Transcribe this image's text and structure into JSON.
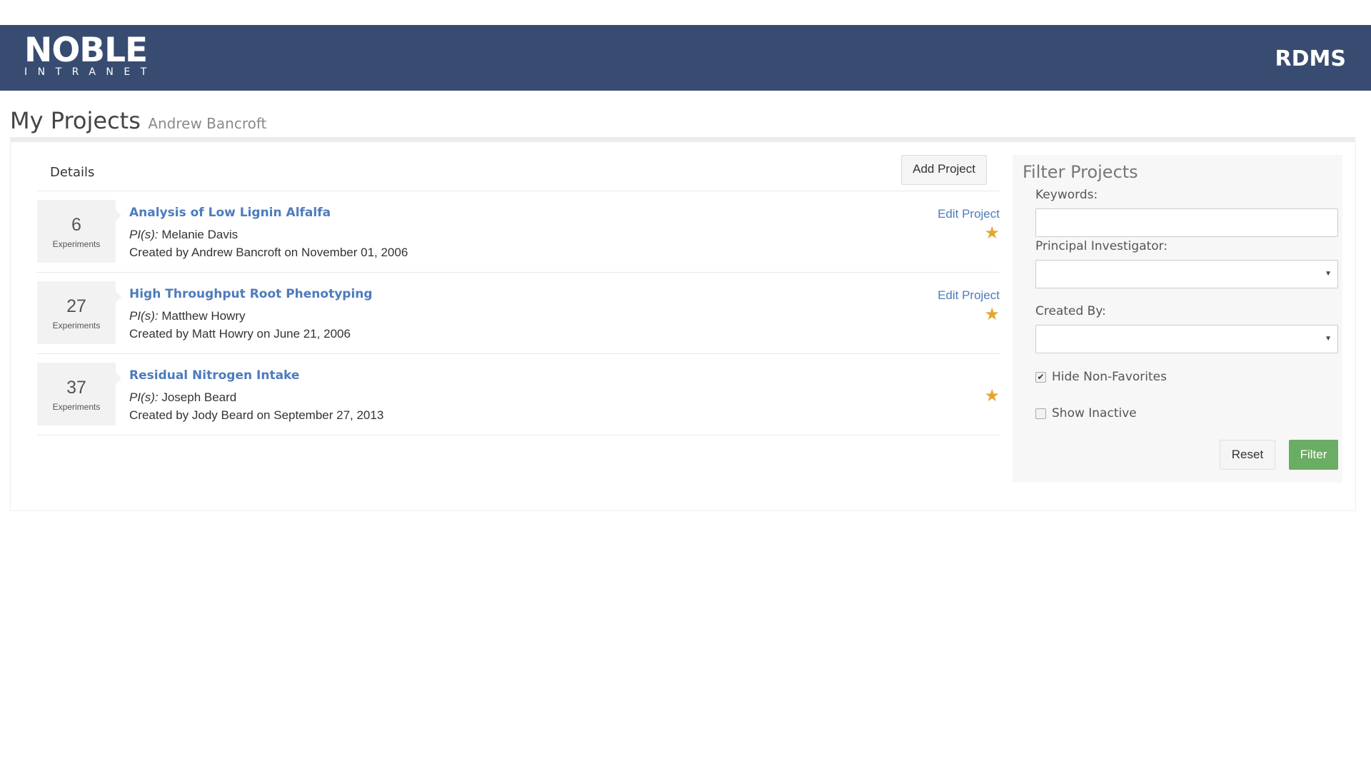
{
  "header": {
    "logo_main": "NOBLE",
    "logo_sub": "INTRANET",
    "app_name": "RDMS"
  },
  "page": {
    "title": "My Projects",
    "user": "Andrew Bancroft"
  },
  "list": {
    "details_label": "Details",
    "add_project_label": "Add Project",
    "experiments_label": "Experiments",
    "pi_label": "PI(s):",
    "edit_label": "Edit Project",
    "projects": [
      {
        "count": "6",
        "title": "Analysis of Low Lignin Alfalfa",
        "pi": "Melanie Davis",
        "created": "Created by Andrew Bancroft on November 01, 2006",
        "editable": true,
        "favorite": true
      },
      {
        "count": "27",
        "title": "High Throughput Root Phenotyping",
        "pi": "Matthew Howry",
        "created": "Created by Matt Howry on June 21, 2006",
        "editable": true,
        "favorite": true
      },
      {
        "count": "37",
        "title": "Residual Nitrogen Intake",
        "pi": "Joseph Beard",
        "created": "Created by Jody Beard on September 27, 2013",
        "editable": false,
        "favorite": true
      }
    ]
  },
  "filter": {
    "title": "Filter Projects",
    "keywords_label": "Keywords:",
    "keywords_value": "",
    "pi_label": "Principal Investigator:",
    "pi_value": "",
    "created_by_label": "Created By:",
    "created_by_value": "",
    "hide_non_favorites_label": "Hide Non-Favorites",
    "hide_non_favorites_checked": true,
    "show_inactive_label": "Show Inactive",
    "show_inactive_checked": false,
    "reset_label": "Reset",
    "filter_label": "Filter"
  },
  "colors": {
    "header_bg": "#384c71",
    "link": "#4d7bbd",
    "star": "#e5a52f",
    "filter_button": "#6aad64"
  }
}
